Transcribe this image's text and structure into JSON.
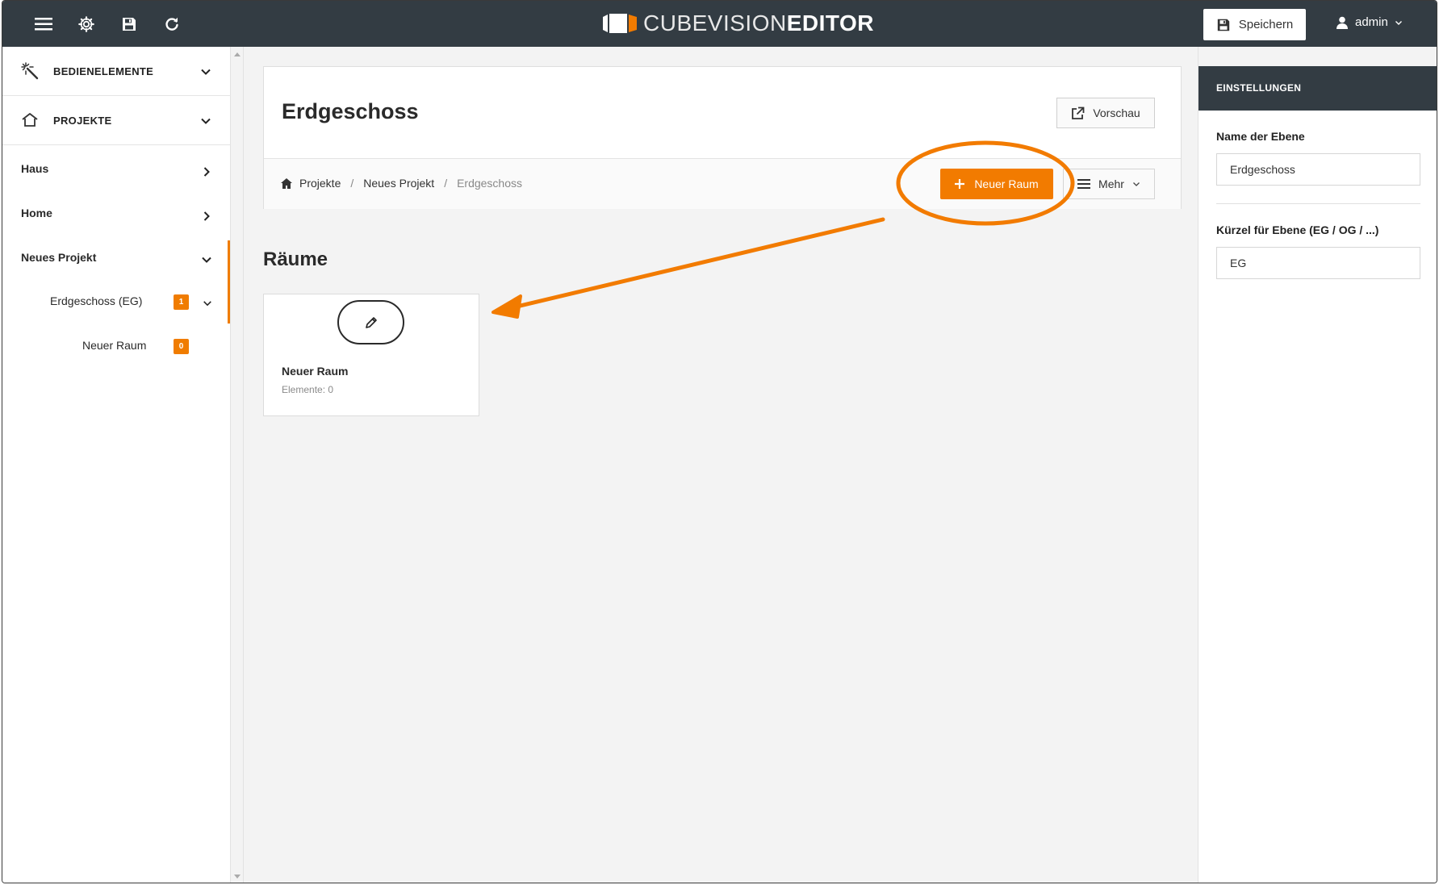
{
  "app": {
    "logo_light": "CUBEVISION",
    "logo_bold": "EDITOR",
    "save_label": "Speichern",
    "user_name": "admin"
  },
  "sidebar": {
    "sections": [
      {
        "label": "BEDIENELEMENTE",
        "icon": "magic-wand-icon"
      },
      {
        "label": "PROJEKTE",
        "icon": "home-icon"
      }
    ],
    "items": [
      {
        "label": "Haus"
      },
      {
        "label": "Home"
      },
      {
        "label": "Neues Projekt"
      }
    ],
    "subitem": {
      "label": "Erdgeschoss (EG)",
      "badge": "1"
    },
    "subsubitem": {
      "label": "Neuer Raum",
      "badge": "0"
    }
  },
  "header": {
    "title": "Erdgeschoss",
    "preview_label": "Vorschau",
    "breadcrumb": [
      "Projekte",
      "Neues Projekt",
      "Erdgeschoss"
    ],
    "new_room_label": "Neuer Raum",
    "more_label": "Mehr"
  },
  "rooms": {
    "title": "Räume",
    "cards": [
      {
        "name": "Neuer Raum",
        "meta": "Elemente: 0"
      }
    ]
  },
  "settings": {
    "title": "EINSTELLUNGEN",
    "name_label": "Name der Ebene",
    "name_value": "Erdgeschoss",
    "short_label": "Kürzel für Ebene (EG / OG / ...)",
    "short_value": "EG"
  },
  "colors": {
    "accent": "#f27b00",
    "topbar": "#333c43"
  }
}
